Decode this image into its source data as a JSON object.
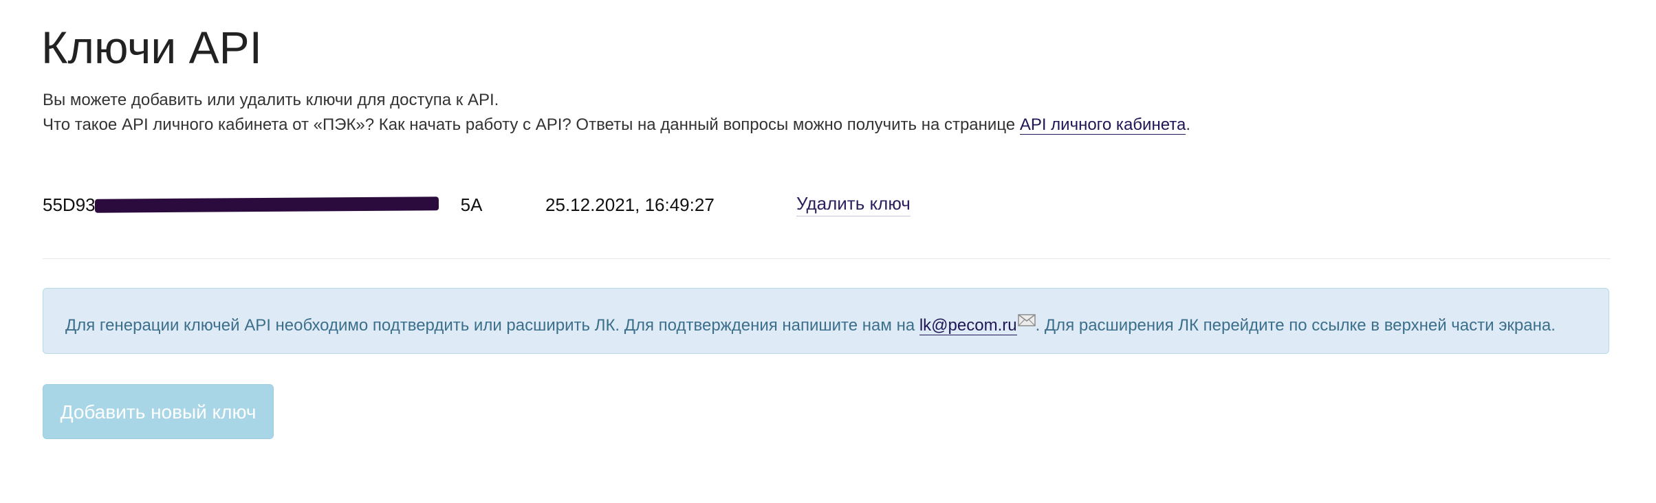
{
  "page": {
    "title": "Ключи API",
    "intro_line1": "Вы можете добавить или удалить ключи для доступа к API.",
    "intro_line2_prefix": "Что такое API личного кабинета от «ПЭК»? Как начать работу с API? Ответы на данный вопросы можно получить на странице ",
    "intro_link": "API личного кабинета",
    "intro_line2_suffix": "."
  },
  "keys": [
    {
      "key_prefix": "55D93",
      "key_suffix": "5A",
      "date": "25.12.2021, 16:49:27",
      "delete_label": "Удалить ключ"
    }
  ],
  "alert": {
    "text_prefix": "Для генерации ключей API необходимо подтвердить или расширить ЛК. Для подтверждения напишите нам на ",
    "email": "lk@pecom.ru",
    "text_suffix": ". Для расширения ЛК перейдите по ссылке в верхней части экрана.",
    "icon": "mail-icon"
  },
  "actions": {
    "add_key_label": "Добавить новый ключ"
  },
  "colors": {
    "link": "#1f1656",
    "alert_bg": "#deeaf5",
    "alert_text": "#3b6f8b",
    "button_disabled": "#a8d6e6",
    "redaction": "#2b0a3d"
  }
}
